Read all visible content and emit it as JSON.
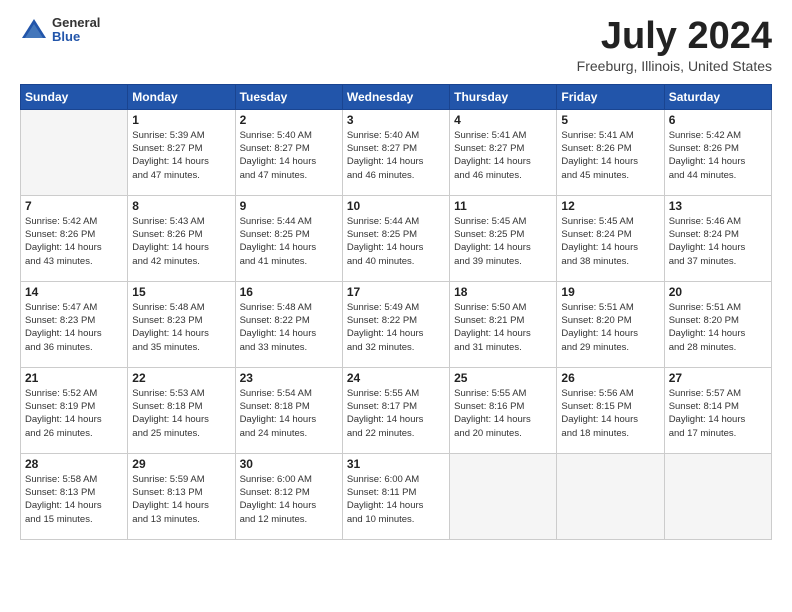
{
  "header": {
    "logo_general": "General",
    "logo_blue": "Blue",
    "month_title": "July 2024",
    "location": "Freeburg, Illinois, United States"
  },
  "days_of_week": [
    "Sunday",
    "Monday",
    "Tuesday",
    "Wednesday",
    "Thursday",
    "Friday",
    "Saturday"
  ],
  "weeks": [
    [
      {
        "day": "",
        "info": ""
      },
      {
        "day": "1",
        "info": "Sunrise: 5:39 AM\nSunset: 8:27 PM\nDaylight: 14 hours\nand 47 minutes."
      },
      {
        "day": "2",
        "info": "Sunrise: 5:40 AM\nSunset: 8:27 PM\nDaylight: 14 hours\nand 47 minutes."
      },
      {
        "day": "3",
        "info": "Sunrise: 5:40 AM\nSunset: 8:27 PM\nDaylight: 14 hours\nand 46 minutes."
      },
      {
        "day": "4",
        "info": "Sunrise: 5:41 AM\nSunset: 8:27 PM\nDaylight: 14 hours\nand 46 minutes."
      },
      {
        "day": "5",
        "info": "Sunrise: 5:41 AM\nSunset: 8:26 PM\nDaylight: 14 hours\nand 45 minutes."
      },
      {
        "day": "6",
        "info": "Sunrise: 5:42 AM\nSunset: 8:26 PM\nDaylight: 14 hours\nand 44 minutes."
      }
    ],
    [
      {
        "day": "7",
        "info": "Sunrise: 5:42 AM\nSunset: 8:26 PM\nDaylight: 14 hours\nand 43 minutes."
      },
      {
        "day": "8",
        "info": "Sunrise: 5:43 AM\nSunset: 8:26 PM\nDaylight: 14 hours\nand 42 minutes."
      },
      {
        "day": "9",
        "info": "Sunrise: 5:44 AM\nSunset: 8:25 PM\nDaylight: 14 hours\nand 41 minutes."
      },
      {
        "day": "10",
        "info": "Sunrise: 5:44 AM\nSunset: 8:25 PM\nDaylight: 14 hours\nand 40 minutes."
      },
      {
        "day": "11",
        "info": "Sunrise: 5:45 AM\nSunset: 8:25 PM\nDaylight: 14 hours\nand 39 minutes."
      },
      {
        "day": "12",
        "info": "Sunrise: 5:45 AM\nSunset: 8:24 PM\nDaylight: 14 hours\nand 38 minutes."
      },
      {
        "day": "13",
        "info": "Sunrise: 5:46 AM\nSunset: 8:24 PM\nDaylight: 14 hours\nand 37 minutes."
      }
    ],
    [
      {
        "day": "14",
        "info": "Sunrise: 5:47 AM\nSunset: 8:23 PM\nDaylight: 14 hours\nand 36 minutes."
      },
      {
        "day": "15",
        "info": "Sunrise: 5:48 AM\nSunset: 8:23 PM\nDaylight: 14 hours\nand 35 minutes."
      },
      {
        "day": "16",
        "info": "Sunrise: 5:48 AM\nSunset: 8:22 PM\nDaylight: 14 hours\nand 33 minutes."
      },
      {
        "day": "17",
        "info": "Sunrise: 5:49 AM\nSunset: 8:22 PM\nDaylight: 14 hours\nand 32 minutes."
      },
      {
        "day": "18",
        "info": "Sunrise: 5:50 AM\nSunset: 8:21 PM\nDaylight: 14 hours\nand 31 minutes."
      },
      {
        "day": "19",
        "info": "Sunrise: 5:51 AM\nSunset: 8:20 PM\nDaylight: 14 hours\nand 29 minutes."
      },
      {
        "day": "20",
        "info": "Sunrise: 5:51 AM\nSunset: 8:20 PM\nDaylight: 14 hours\nand 28 minutes."
      }
    ],
    [
      {
        "day": "21",
        "info": "Sunrise: 5:52 AM\nSunset: 8:19 PM\nDaylight: 14 hours\nand 26 minutes."
      },
      {
        "day": "22",
        "info": "Sunrise: 5:53 AM\nSunset: 8:18 PM\nDaylight: 14 hours\nand 25 minutes."
      },
      {
        "day": "23",
        "info": "Sunrise: 5:54 AM\nSunset: 8:18 PM\nDaylight: 14 hours\nand 24 minutes."
      },
      {
        "day": "24",
        "info": "Sunrise: 5:55 AM\nSunset: 8:17 PM\nDaylight: 14 hours\nand 22 minutes."
      },
      {
        "day": "25",
        "info": "Sunrise: 5:55 AM\nSunset: 8:16 PM\nDaylight: 14 hours\nand 20 minutes."
      },
      {
        "day": "26",
        "info": "Sunrise: 5:56 AM\nSunset: 8:15 PM\nDaylight: 14 hours\nand 18 minutes."
      },
      {
        "day": "27",
        "info": "Sunrise: 5:57 AM\nSunset: 8:14 PM\nDaylight: 14 hours\nand 17 minutes."
      }
    ],
    [
      {
        "day": "28",
        "info": "Sunrise: 5:58 AM\nSunset: 8:13 PM\nDaylight: 14 hours\nand 15 minutes."
      },
      {
        "day": "29",
        "info": "Sunrise: 5:59 AM\nSunset: 8:13 PM\nDaylight: 14 hours\nand 13 minutes."
      },
      {
        "day": "30",
        "info": "Sunrise: 6:00 AM\nSunset: 8:12 PM\nDaylight: 14 hours\nand 12 minutes."
      },
      {
        "day": "31",
        "info": "Sunrise: 6:00 AM\nSunset: 8:11 PM\nDaylight: 14 hours\nand 10 minutes."
      },
      {
        "day": "",
        "info": ""
      },
      {
        "day": "",
        "info": ""
      },
      {
        "day": "",
        "info": ""
      }
    ]
  ]
}
